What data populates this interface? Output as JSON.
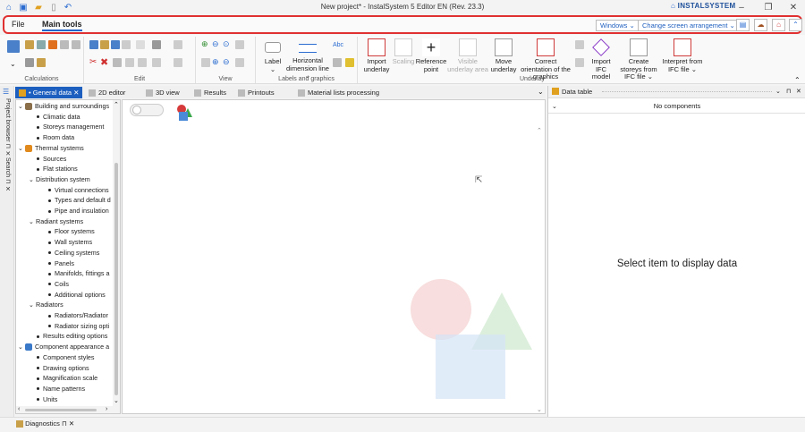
{
  "window": {
    "title": "New project* - InstalSystem 5 Editor EN (Rev. 23.3)",
    "brand": "INSTALSYSTEM",
    "min": "–",
    "max": "❐",
    "close": "✕"
  },
  "ribbon_tabs": {
    "file": "File",
    "main": "Main tools"
  },
  "ribbon_right": {
    "windows": "Windows ⌄",
    "arrangement": "Change screen arrangement ⌄"
  },
  "groups": {
    "calculations": "Calculations",
    "edit": "Edit",
    "view": "View",
    "labels": "Labels and graphics",
    "underlay": "Underlay"
  },
  "buttons": {
    "label": "Label",
    "hdim": "Horizontal dimension line",
    "abc": "Abc",
    "import_underlay": "Import underlay",
    "scaling": "Scaling",
    "ref_point": "Reference point",
    "visible_area": "Visible underlay area",
    "move_underlay": "Move underlay",
    "correct_orient": "Correct orientation of the graphics",
    "import_ifc": "Import IFC model",
    "create_storeys": "Create storeys from IFC file ⌄",
    "interpret": "Interpret from IFC file ⌄"
  },
  "doc_tabs": [
    {
      "label": "• General data"
    },
    {
      "label": "2D editor"
    },
    {
      "label": "3D view"
    },
    {
      "label": "Results"
    },
    {
      "label": "Printouts"
    },
    {
      "label": "Material lists processing"
    }
  ],
  "side": {
    "project_browser": "Project browser",
    "search": "Search"
  },
  "tree": [
    {
      "label": "Building and surroundings",
      "lvl": 0,
      "kind": "exp",
      "color": "#8a6f4a"
    },
    {
      "label": "Climatic data",
      "lvl": 1,
      "kind": "bul"
    },
    {
      "label": "Storeys management",
      "lvl": 1,
      "kind": "bul"
    },
    {
      "label": "Room data",
      "lvl": 1,
      "kind": "bul"
    },
    {
      "label": "Thermal systems",
      "lvl": 0,
      "kind": "exp",
      "color": "#e08a1e"
    },
    {
      "label": "Sources",
      "lvl": 1,
      "kind": "bul"
    },
    {
      "label": "Flat stations",
      "lvl": 1,
      "kind": "bul"
    },
    {
      "label": "Distribution system",
      "lvl": 1,
      "kind": "exp"
    },
    {
      "label": "Virtual connections",
      "lvl": 2,
      "kind": "bul"
    },
    {
      "label": "Types and default d",
      "lvl": 2,
      "kind": "bul"
    },
    {
      "label": "Pipe and insulation",
      "lvl": 2,
      "kind": "bul"
    },
    {
      "label": "Radiant systems",
      "lvl": 1,
      "kind": "exp"
    },
    {
      "label": "Floor systems",
      "lvl": 2,
      "kind": "bul"
    },
    {
      "label": "Wall systems",
      "lvl": 2,
      "kind": "bul"
    },
    {
      "label": "Ceiling systems",
      "lvl": 2,
      "kind": "bul"
    },
    {
      "label": "Panels",
      "lvl": 2,
      "kind": "bul"
    },
    {
      "label": "Manifolds, fittings a",
      "lvl": 2,
      "kind": "bul"
    },
    {
      "label": "Coils",
      "lvl": 2,
      "kind": "bul"
    },
    {
      "label": "Additional options",
      "lvl": 2,
      "kind": "bul"
    },
    {
      "label": "Radiators",
      "lvl": 1,
      "kind": "exp"
    },
    {
      "label": "Radiators/Radiator",
      "lvl": 2,
      "kind": "bul"
    },
    {
      "label": "Radiator sizing opti",
      "lvl": 2,
      "kind": "bul"
    },
    {
      "label": "Results editing options",
      "lvl": 1,
      "kind": "bul"
    },
    {
      "label": "Component appearance a",
      "lvl": 0,
      "kind": "exp",
      "color": "#3a78c8"
    },
    {
      "label": "Component styles",
      "lvl": 1,
      "kind": "bul"
    },
    {
      "label": "Drawing options",
      "lvl": 1,
      "kind": "bul"
    },
    {
      "label": "Magnification scale",
      "lvl": 1,
      "kind": "bul"
    },
    {
      "label": "Name patterns",
      "lvl": 1,
      "kind": "bul"
    },
    {
      "label": "Units",
      "lvl": 1,
      "kind": "bul"
    }
  ],
  "right_panel": {
    "title": "Data table",
    "no_components": "No components",
    "placeholder": "Select item to display data"
  },
  "bottom": {
    "diagnostics": "Diagnostics"
  }
}
